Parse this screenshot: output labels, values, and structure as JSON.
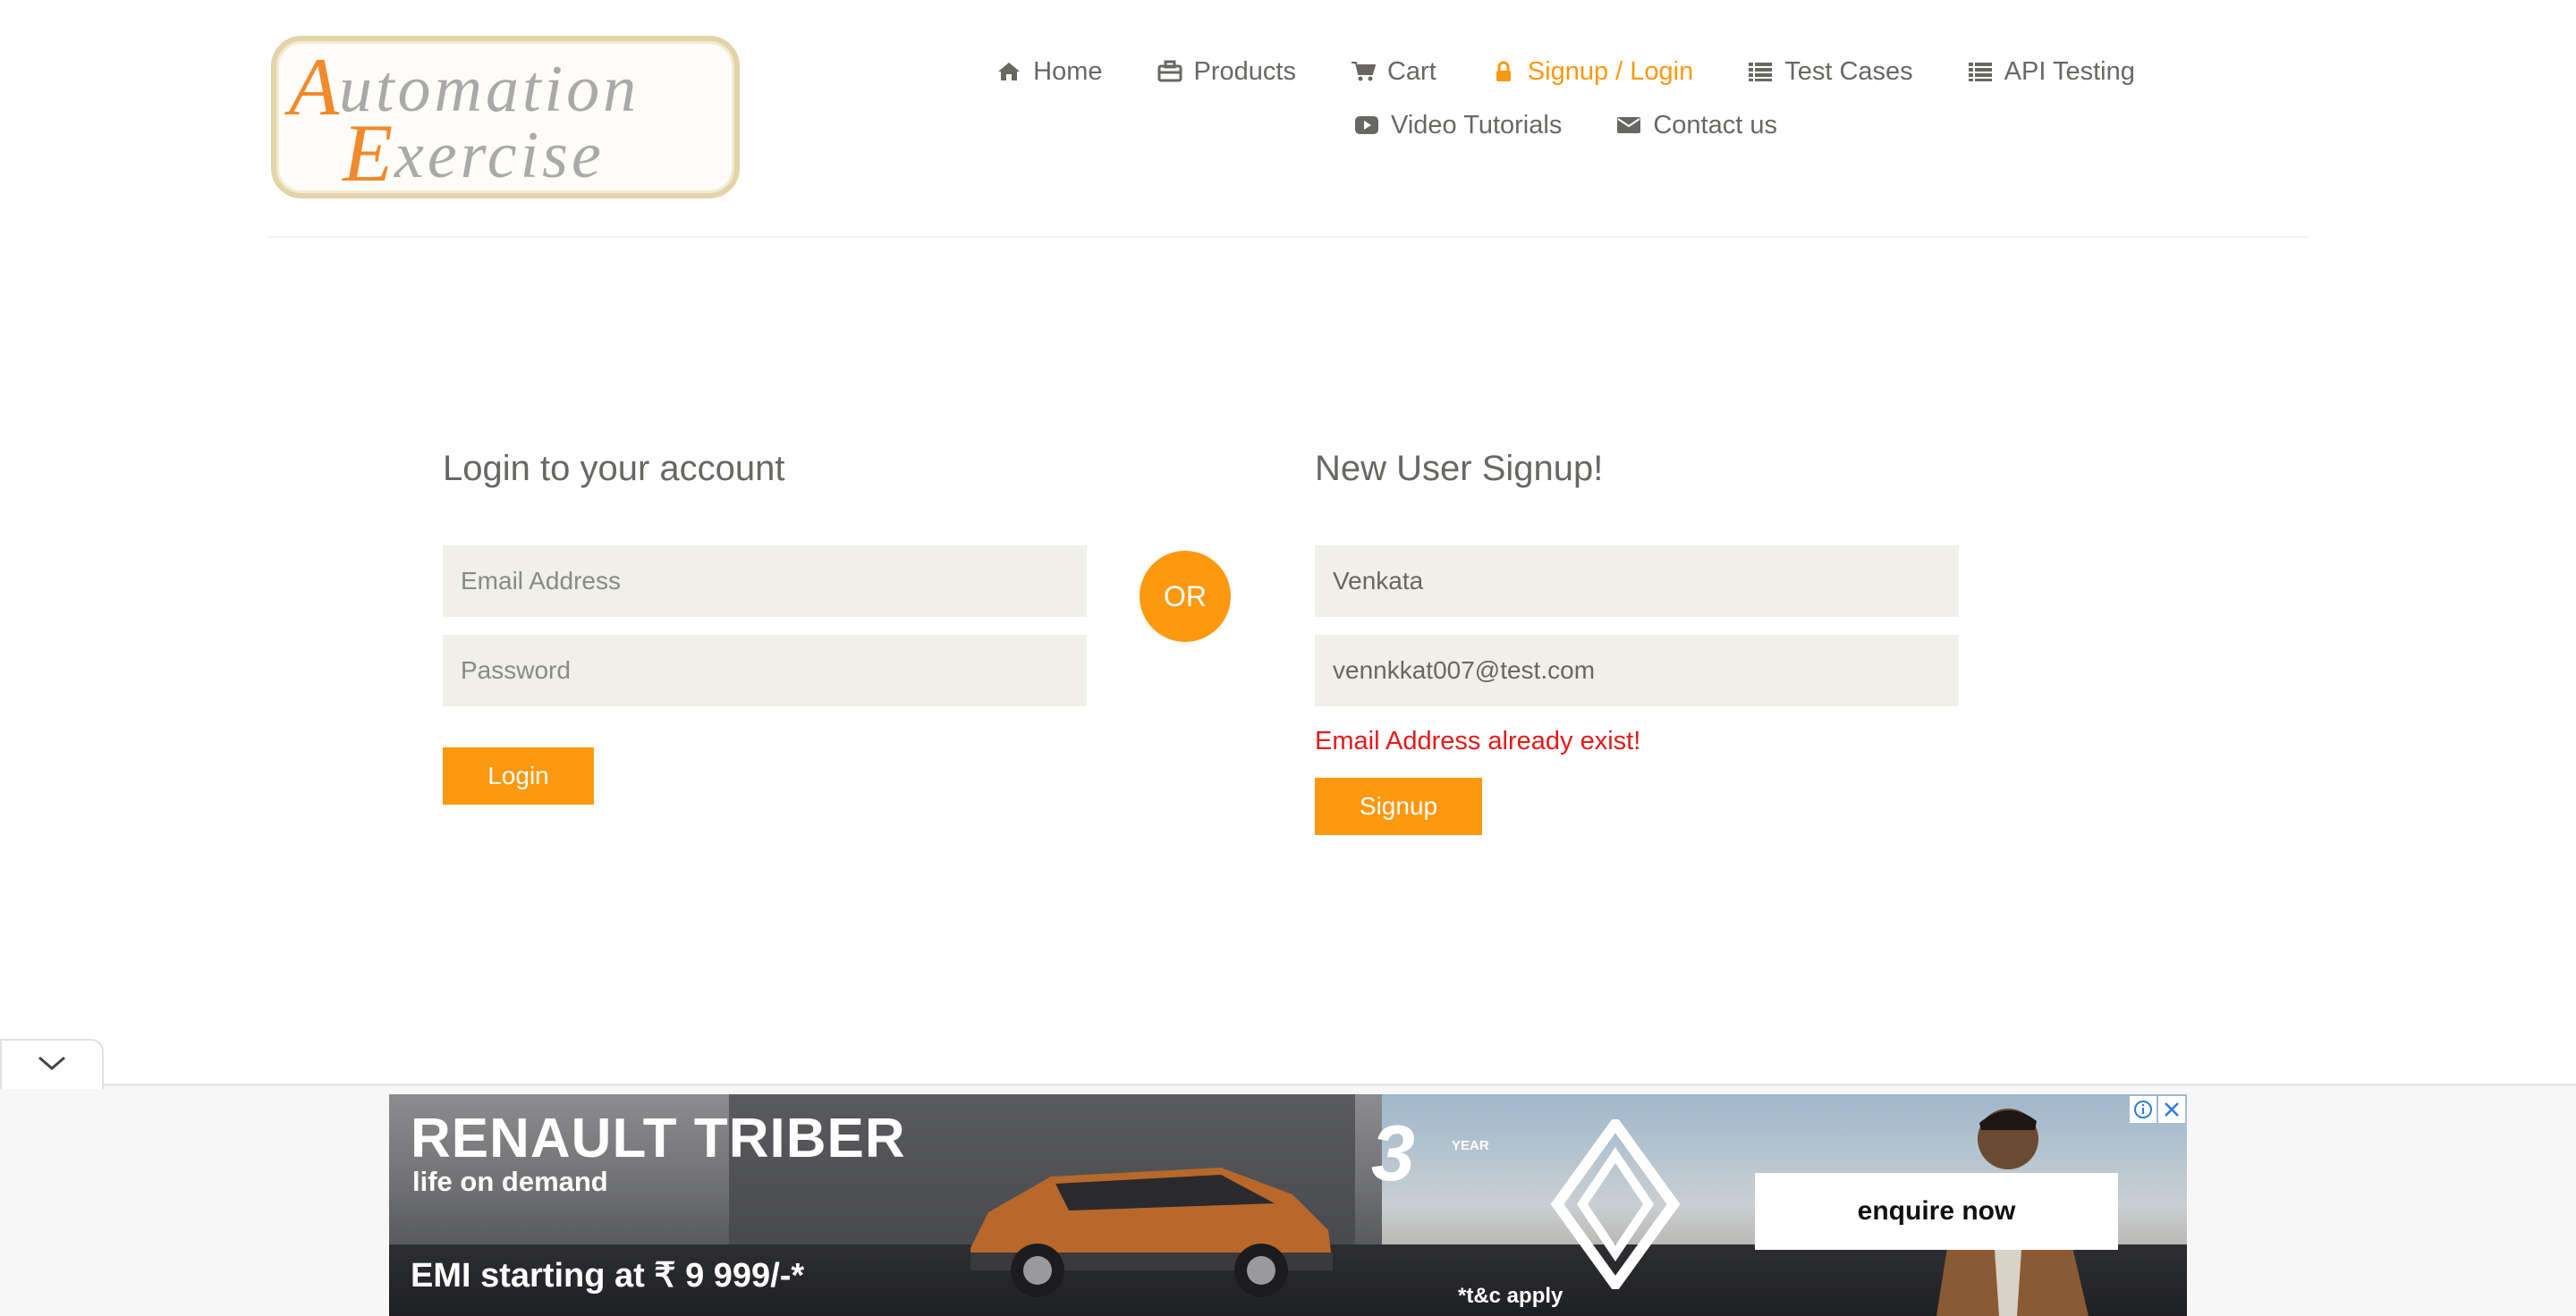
{
  "header": {
    "logo_text": "Automation Exercise",
    "nav_row1": [
      {
        "label": "Home",
        "icon": "home-icon"
      },
      {
        "label": "Products",
        "icon": "briefcase-icon"
      },
      {
        "label": "Cart",
        "icon": "cart-icon"
      },
      {
        "label": "Signup / Login",
        "icon": "lock-icon",
        "active": true
      },
      {
        "label": "Test Cases",
        "icon": "list-icon"
      },
      {
        "label": "API Testing",
        "icon": "list-icon"
      }
    ],
    "nav_row2": [
      {
        "label": "Video Tutorials",
        "icon": "youtube-play-icon"
      },
      {
        "label": "Contact us",
        "icon": "envelope-icon"
      }
    ]
  },
  "login": {
    "title": "Login to your account",
    "email_placeholder": "Email Address",
    "password_placeholder": "Password",
    "button": "Login"
  },
  "divider": {
    "label": "OR"
  },
  "signup": {
    "title": "New User Signup!",
    "name_value": "Venkata",
    "email_value": "vennkkat007@test.com",
    "error": "Email Address already exist!",
    "button": "Signup"
  },
  "ad": {
    "title": "RENAULT TRIBER",
    "subtitle": "life on demand",
    "emi": "EMI starting at ₹ 9 999/-*",
    "warranty_number": "3",
    "warranty_label": "YEAR",
    "terms": "*t&c apply",
    "cta": "enquire now"
  },
  "colors": {
    "accent": "#fe980f",
    "error": "#e21b1b",
    "text": "#696763",
    "input_bg": "#f0f0e9"
  }
}
